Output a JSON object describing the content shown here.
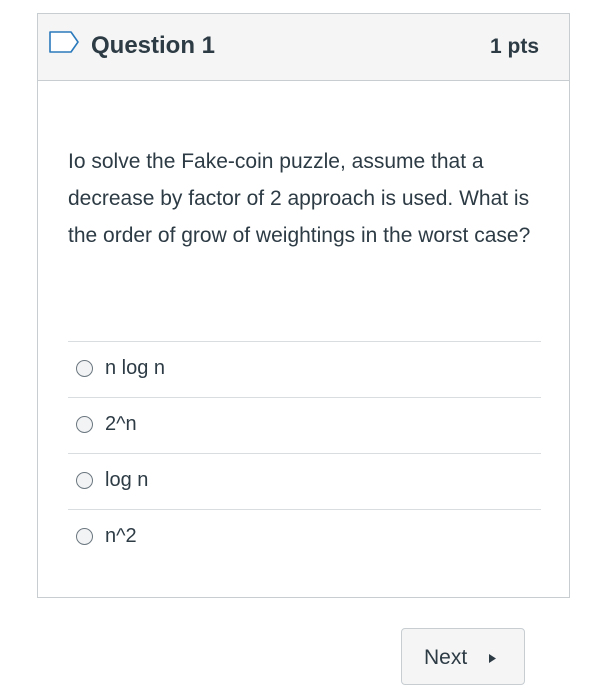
{
  "question": {
    "title": "Question 1",
    "points": "1 pts",
    "text": "Io solve the Fake-coin puzzle, assume that a decrease by factor of 2 approach is used. What is the order of grow of weightings in the worst case?",
    "flag_icon": "flag-outline-icon"
  },
  "answers": [
    {
      "label": "n log n",
      "selected": false
    },
    {
      "label": "2^n",
      "selected": false
    },
    {
      "label": "log n",
      "selected": false
    },
    {
      "label": "n^2",
      "selected": false
    }
  ],
  "navigation": {
    "next_label": "Next",
    "next_icon": "caret-right-icon"
  },
  "colors": {
    "text": "#2d3b45",
    "border": "#c7cdd1",
    "header_background": "#f5f5f5",
    "flag_outline": "#2b7abc"
  }
}
